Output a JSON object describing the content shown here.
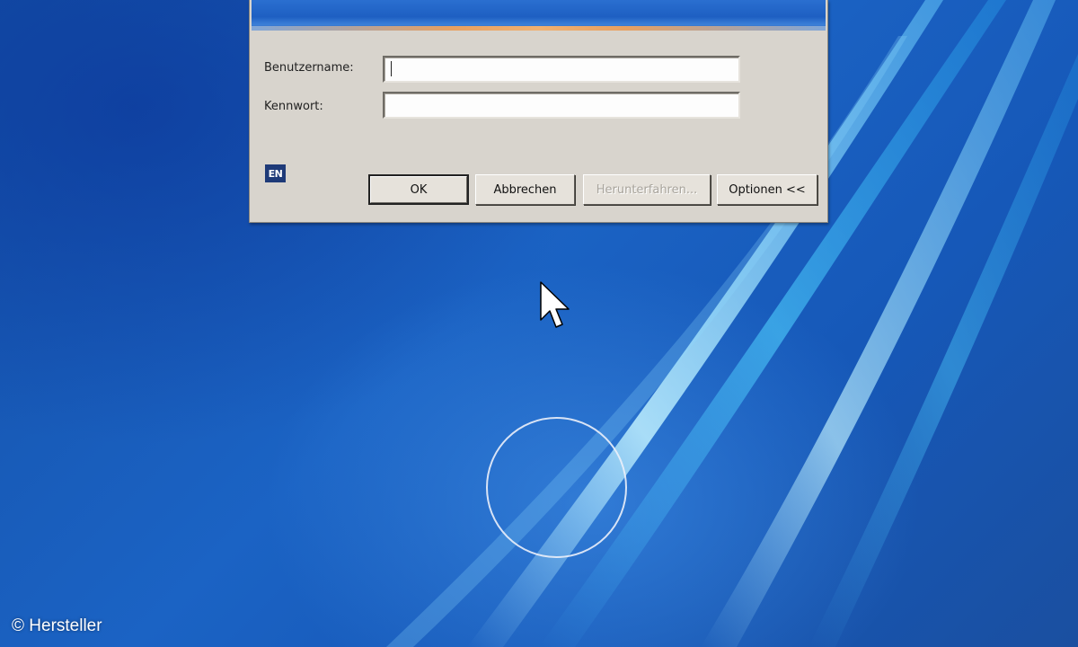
{
  "dialog": {
    "username_label": "Benutzername:",
    "username_value": "",
    "password_label": "Kennwort:",
    "password_value": "",
    "language_indicator": "EN",
    "buttons": {
      "ok": "OK",
      "cancel": "Abbrechen",
      "shutdown": "Herunterfahren...",
      "options": "Optionen <<"
    }
  },
  "copyright": "© Hersteller",
  "colors": {
    "desktop_blue": "#1b63c4",
    "dialog_face": "#d8d4cd",
    "language_indicator_bg": "#1e3a78"
  },
  "icons": {
    "cursor": "arrow-pointer-icon",
    "highlight": "circle-highlight"
  }
}
